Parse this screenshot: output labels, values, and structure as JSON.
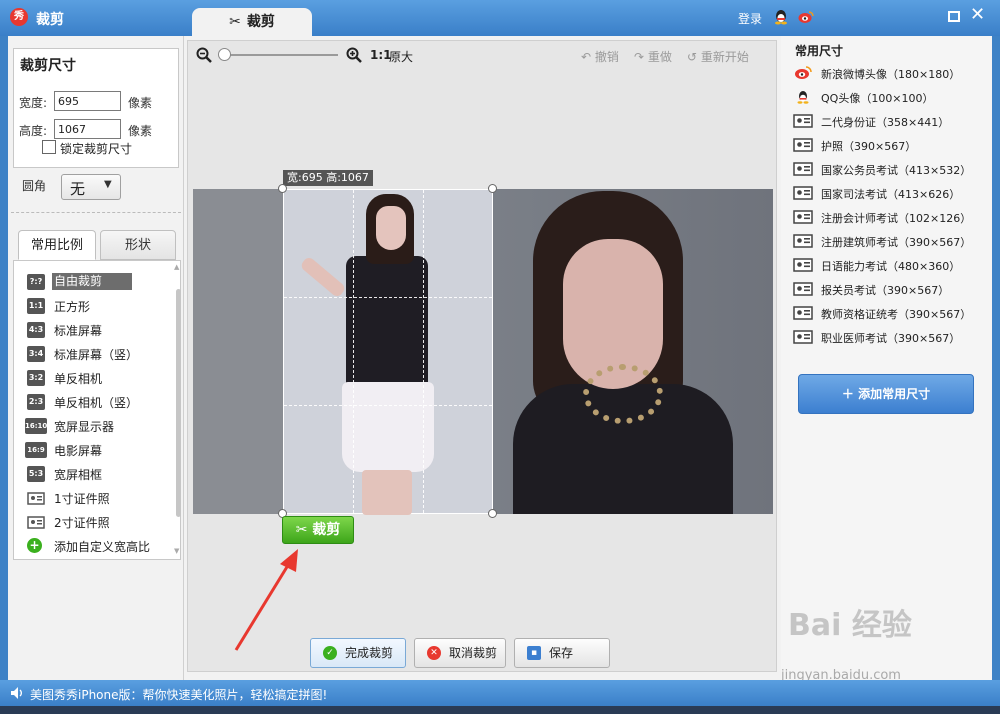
{
  "app": {
    "logo_text": "秀",
    "title": "裁剪",
    "tab_label": "裁剪",
    "login": "登录"
  },
  "crop_size": {
    "title": "裁剪尺寸",
    "width_label": "宽度:",
    "width_value": "695",
    "width_unit": "像素",
    "height_label": "高度:",
    "height_value": "1067",
    "height_unit": "像素",
    "lock_label": "锁定裁剪尺寸",
    "corner_label": "圆角",
    "corner_value": "无"
  },
  "tabs": {
    "common_ratio": "常用比例",
    "shape": "形状"
  },
  "ratios": [
    {
      "badge": "?:?",
      "label": "自由裁剪",
      "selected": true
    },
    {
      "badge": "1:1",
      "label": "正方形"
    },
    {
      "badge": "4:3",
      "label": "标准屏幕"
    },
    {
      "badge": "3:4",
      "label": "标准屏幕（竖）"
    },
    {
      "badge": "3:2",
      "label": "单反相机"
    },
    {
      "badge": "2:3",
      "label": "单反相机（竖）"
    },
    {
      "badge": "16:10",
      "label": "宽屏显示器"
    },
    {
      "badge": "16:9",
      "label": "电影屏幕"
    },
    {
      "badge": "5:3",
      "label": "宽屏相框"
    },
    {
      "badge": "id",
      "label": "1寸证件照"
    },
    {
      "badge": "id",
      "label": "2寸证件照"
    },
    {
      "badge": "+",
      "label": "添加自定义宽高比"
    }
  ],
  "toolbar": {
    "zoom_ratio": "1:1",
    "zoom_orig": "原大",
    "undo": "撤销",
    "redo": "重做",
    "restart": "重新开始"
  },
  "canvas": {
    "dimension_label": "宽:695 高:1067",
    "crop_button": "裁剪"
  },
  "actions": {
    "done": "完成裁剪",
    "cancel": "取消裁剪",
    "save": "保存"
  },
  "common_sizes": {
    "title": "常用尺寸",
    "items": [
      {
        "icon": "weibo",
        "label": "新浪微博头像（180×180）"
      },
      {
        "icon": "qq",
        "label": "QQ头像（100×100）"
      },
      {
        "icon": "id-card",
        "label": "二代身份证（358×441）"
      },
      {
        "icon": "id-card",
        "label": "护照（390×567）"
      },
      {
        "icon": "id-card",
        "label": "国家公务员考试（413×532）"
      },
      {
        "icon": "id-card",
        "label": "国家司法考试（413×626）"
      },
      {
        "icon": "id-card",
        "label": "注册会计师考试（102×126）"
      },
      {
        "icon": "id-card",
        "label": "注册建筑师考试（390×567）"
      },
      {
        "icon": "id-card",
        "label": "日语能力考试（480×360）"
      },
      {
        "icon": "id-card",
        "label": "报关员考试（390×567）"
      },
      {
        "icon": "id-card",
        "label": "教师资格证统考（390×567）"
      },
      {
        "icon": "id-card",
        "label": "职业医师考试（390×567）"
      }
    ],
    "add_button": "添加常用尺寸"
  },
  "watermark": {
    "brand": "Bai 经验",
    "url": "jingyan.baidu.com"
  },
  "status": {
    "message": "美图秀秀iPhone版：帮你快速美化照片，轻松搞定拼图!"
  },
  "colors": {
    "title_bar": "#3a7fc8",
    "crop_green": "#3da51a",
    "add_button_blue": "#3c7fd0",
    "arrow_red": "#e8382f"
  }
}
